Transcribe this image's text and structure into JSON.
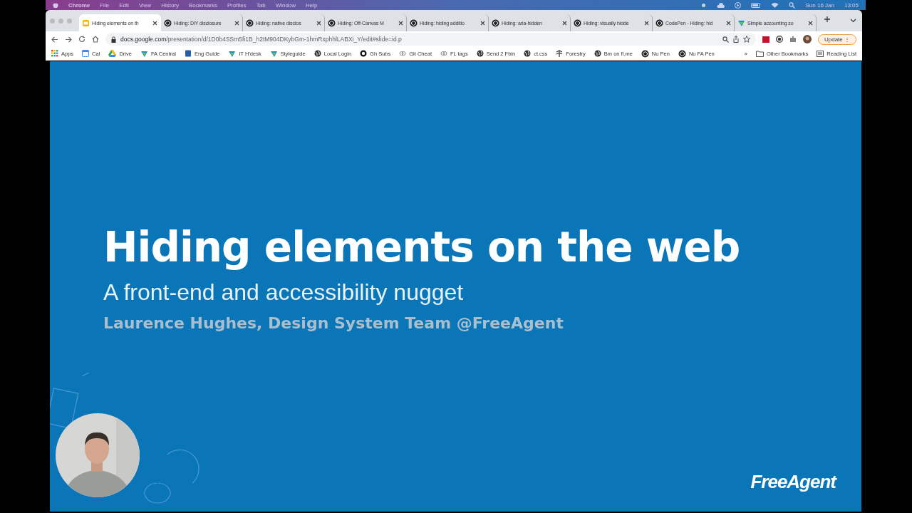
{
  "menu_bar": {
    "app": "Chrome",
    "items": [
      "File",
      "Edit",
      "View",
      "History",
      "Bookmarks",
      "Profiles",
      "Tab",
      "Window",
      "Help"
    ],
    "date": "Sun 16 Jan",
    "time": "13:05"
  },
  "tabs": [
    {
      "title": "Hiding elements on th",
      "selected": true,
      "kind": "slides"
    },
    {
      "title": "Hiding: DIY disclosure",
      "selected": false,
      "kind": "codepen"
    },
    {
      "title": "Hiding: native disclos",
      "selected": false,
      "kind": "codepen"
    },
    {
      "title": "Hiding: Off-Canvas M",
      "selected": false,
      "kind": "codepen"
    },
    {
      "title": "Hiding: hiding additio",
      "selected": false,
      "kind": "codepen"
    },
    {
      "title": "Hiding: aria-hidden",
      "selected": false,
      "kind": "codepen"
    },
    {
      "title": "Hiding: visually hidde",
      "selected": false,
      "kind": "codepen"
    },
    {
      "title": "CodePen - Hiding: hid",
      "selected": false,
      "kind": "codepen"
    },
    {
      "title": "Simple accounting so",
      "selected": false,
      "kind": "freeagent"
    }
  ],
  "address": {
    "host": "docs.google.com",
    "path": "/presentation/d/1D0b4SSm5fi1B_h2tM904DKybGm-1hmRxphhlLABXi_Y/edit#slide=id.p"
  },
  "update_button": "Update",
  "update_menu": "⋮",
  "bookmarks": [
    {
      "label": "Apps",
      "kind": "grid"
    },
    {
      "label": "Cal",
      "kind": "calendar"
    },
    {
      "label": "Drive",
      "kind": "drive"
    },
    {
      "label": "FA Central",
      "kind": "freeagent"
    },
    {
      "label": "Eng Guide",
      "kind": "book"
    },
    {
      "label": "IT H'desk",
      "kind": "freeagent"
    },
    {
      "label": "Styleguide",
      "kind": "freeagent"
    },
    {
      "label": "Local Login",
      "kind": "globe"
    },
    {
      "label": "Gh Subs",
      "kind": "github"
    },
    {
      "label": "Git Cheat",
      "kind": "link"
    },
    {
      "label": "FL tags",
      "kind": "link"
    },
    {
      "label": "Send 2 Fbin",
      "kind": "globe"
    },
    {
      "label": "ct.css",
      "kind": "globe"
    },
    {
      "label": "Forestry",
      "kind": "tree"
    },
    {
      "label": "Bm on fl.me",
      "kind": "globe"
    },
    {
      "label": "Nu Pen",
      "kind": "codepen"
    },
    {
      "label": "Nu FA Pen",
      "kind": "codepen"
    }
  ],
  "bookmarks_overflow": "»",
  "other_bookmarks": "Other Bookmarks",
  "reading_list": "Reading List",
  "slide": {
    "title": "Hiding elements on the web",
    "subtitle": "A front-end and accessibility nugget",
    "author": "Laurence Hughes, Design System Team @FreeAgent",
    "logo": "FreeAgent"
  }
}
